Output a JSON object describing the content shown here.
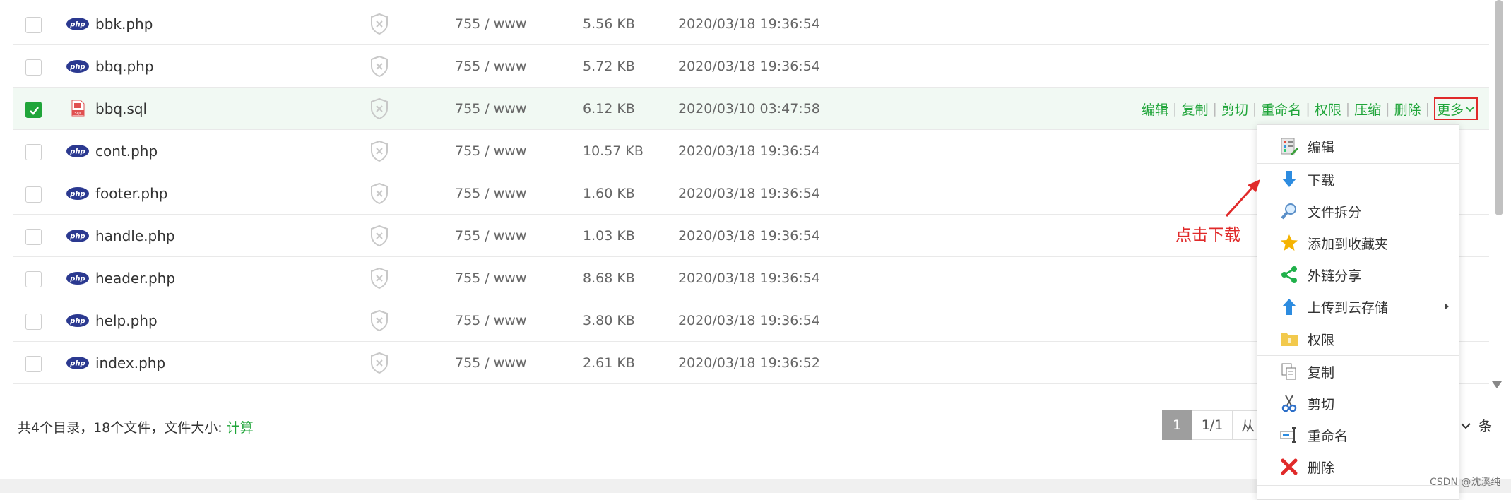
{
  "files": [
    {
      "name": "bbk.php",
      "type": "php",
      "perm": "755 / www",
      "size": "5.56 KB",
      "date": "2020/03/18 19:36:54",
      "checked": false
    },
    {
      "name": "bbq.php",
      "type": "php",
      "perm": "755 / www",
      "size": "5.72 KB",
      "date": "2020/03/18 19:36:54",
      "checked": false
    },
    {
      "name": "bbq.sql",
      "type": "sql",
      "perm": "755 / www",
      "size": "6.12 KB",
      "date": "2020/03/10 03:47:58",
      "checked": true
    },
    {
      "name": "cont.php",
      "type": "php",
      "perm": "755 / www",
      "size": "10.57 KB",
      "date": "2020/03/18 19:36:54",
      "checked": false
    },
    {
      "name": "footer.php",
      "type": "php",
      "perm": "755 / www",
      "size": "1.60 KB",
      "date": "2020/03/18 19:36:54",
      "checked": false
    },
    {
      "name": "handle.php",
      "type": "php",
      "perm": "755 / www",
      "size": "1.03 KB",
      "date": "2020/03/18 19:36:54",
      "checked": false
    },
    {
      "name": "header.php",
      "type": "php",
      "perm": "755 / www",
      "size": "8.68 KB",
      "date": "2020/03/18 19:36:54",
      "checked": false
    },
    {
      "name": "help.php",
      "type": "php",
      "perm": "755 / www",
      "size": "3.80 KB",
      "date": "2020/03/18 19:36:54",
      "checked": false
    },
    {
      "name": "index.php",
      "type": "php",
      "perm": "755 / www",
      "size": "2.61 KB",
      "date": "2020/03/18 19:36:52",
      "checked": false
    }
  ],
  "row_ops": [
    "编辑",
    "复制",
    "剪切",
    "重命名",
    "权限",
    "压缩",
    "删除"
  ],
  "more_label": "更多",
  "menu": {
    "items": [
      "编辑",
      "下载",
      "文件拆分",
      "添加到收藏夹",
      "外链分享",
      "上传到云存储",
      "权限",
      "复制",
      "剪切",
      "重命名",
      "删除"
    ]
  },
  "footer": {
    "summary": "共4个目录，18个文件，文件大小: ",
    "calc": "计算",
    "page_current": "1",
    "page_info": "1/1",
    "page_from": "从",
    "per_page_unit": "条"
  },
  "annotation": "点击下载",
  "watermark": "CSDN @沈溪纯",
  "colors": {
    "accent": "#20a53a",
    "annotation": "#e02a2a",
    "php_icon": "#2b3990"
  }
}
